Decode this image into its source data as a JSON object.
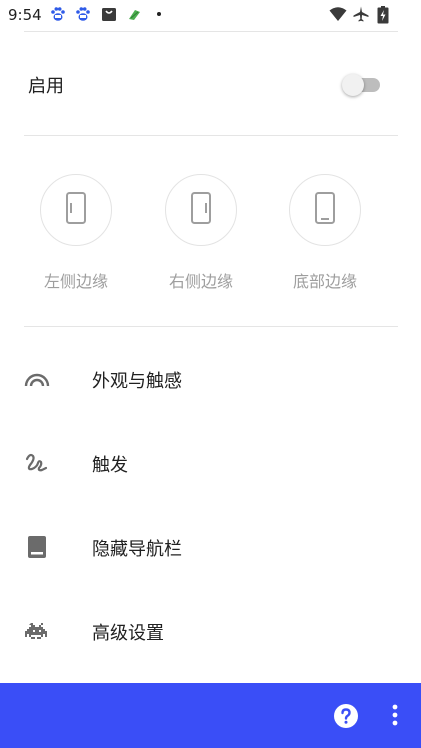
{
  "status_bar": {
    "time": "9:54",
    "icons": [
      "baidu-paw-icon",
      "baidu-paw-icon",
      "shopping-bag-icon",
      "android-icon",
      "notification-dot",
      "wifi-icon",
      "airplane-icon",
      "battery-charging-icon"
    ]
  },
  "enable": {
    "label": "启用",
    "toggle_on": false
  },
  "edges": [
    {
      "label": "左侧边缘",
      "icon": "left-edge-phone-icon"
    },
    {
      "label": "右侧边缘",
      "icon": "right-edge-phone-icon"
    },
    {
      "label": "底部边缘",
      "icon": "bottom-edge-phone-icon"
    }
  ],
  "menu": [
    {
      "label": "外观与触感",
      "icon": "rainbow-arc-icon"
    },
    {
      "label": "触发",
      "icon": "gesture-icon"
    },
    {
      "label": "隐藏导航栏",
      "icon": "hide-navbar-icon"
    },
    {
      "label": "高级设置",
      "icon": "space-invader-icon"
    }
  ],
  "colors": {
    "bottom_bar": "#3a4ef7",
    "icon_gray": "#9e9e9e",
    "text": "#212121"
  }
}
